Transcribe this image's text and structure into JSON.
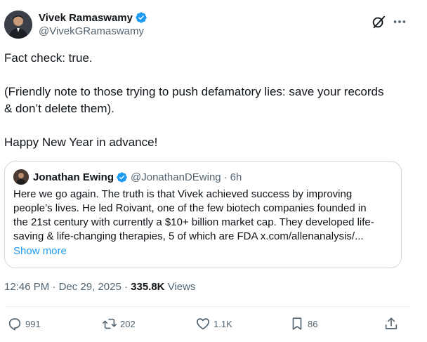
{
  "author": {
    "display_name": "Vivek Ramaswamy",
    "handle": "@VivekGRamaswamy"
  },
  "post": {
    "line1": "Fact check: true.",
    "line2": "(Friendly note to those trying to push defamatory lies: save your records",
    "line3": "& don’t delete them).",
    "line4": "Happy New Year in advance!"
  },
  "quote": {
    "display_name": "Jonathan Ewing",
    "handle": "@JonathanDEwing",
    "separator": "·",
    "time": "6h",
    "lines": [
      "Here we go again. The truth is that Vivek achieved success by improving",
      "people’s lives. He led Roivant, one of the few biotech companies founded in",
      "the 21st century with currently a $10+ billion market cap. They developed life-",
      "saving & life-changing therapies, 5 of which are FDA x.com/allenanalysis/..."
    ],
    "show_more": "Show more"
  },
  "meta": {
    "time": "12:46 PM",
    "separator": "·",
    "date": "Dec 29, 2025",
    "separator2": "·",
    "views_count": "335.8K",
    "views_label": "Views"
  },
  "actions": {
    "replies": "991",
    "reposts": "202",
    "likes": "1.1K",
    "bookmarks": "86"
  },
  "colors": {
    "verified": "#1d9bf0",
    "link": "#1d9bf0",
    "muted": "#536471",
    "text": "#0f1419",
    "border": "#cfd9de"
  }
}
